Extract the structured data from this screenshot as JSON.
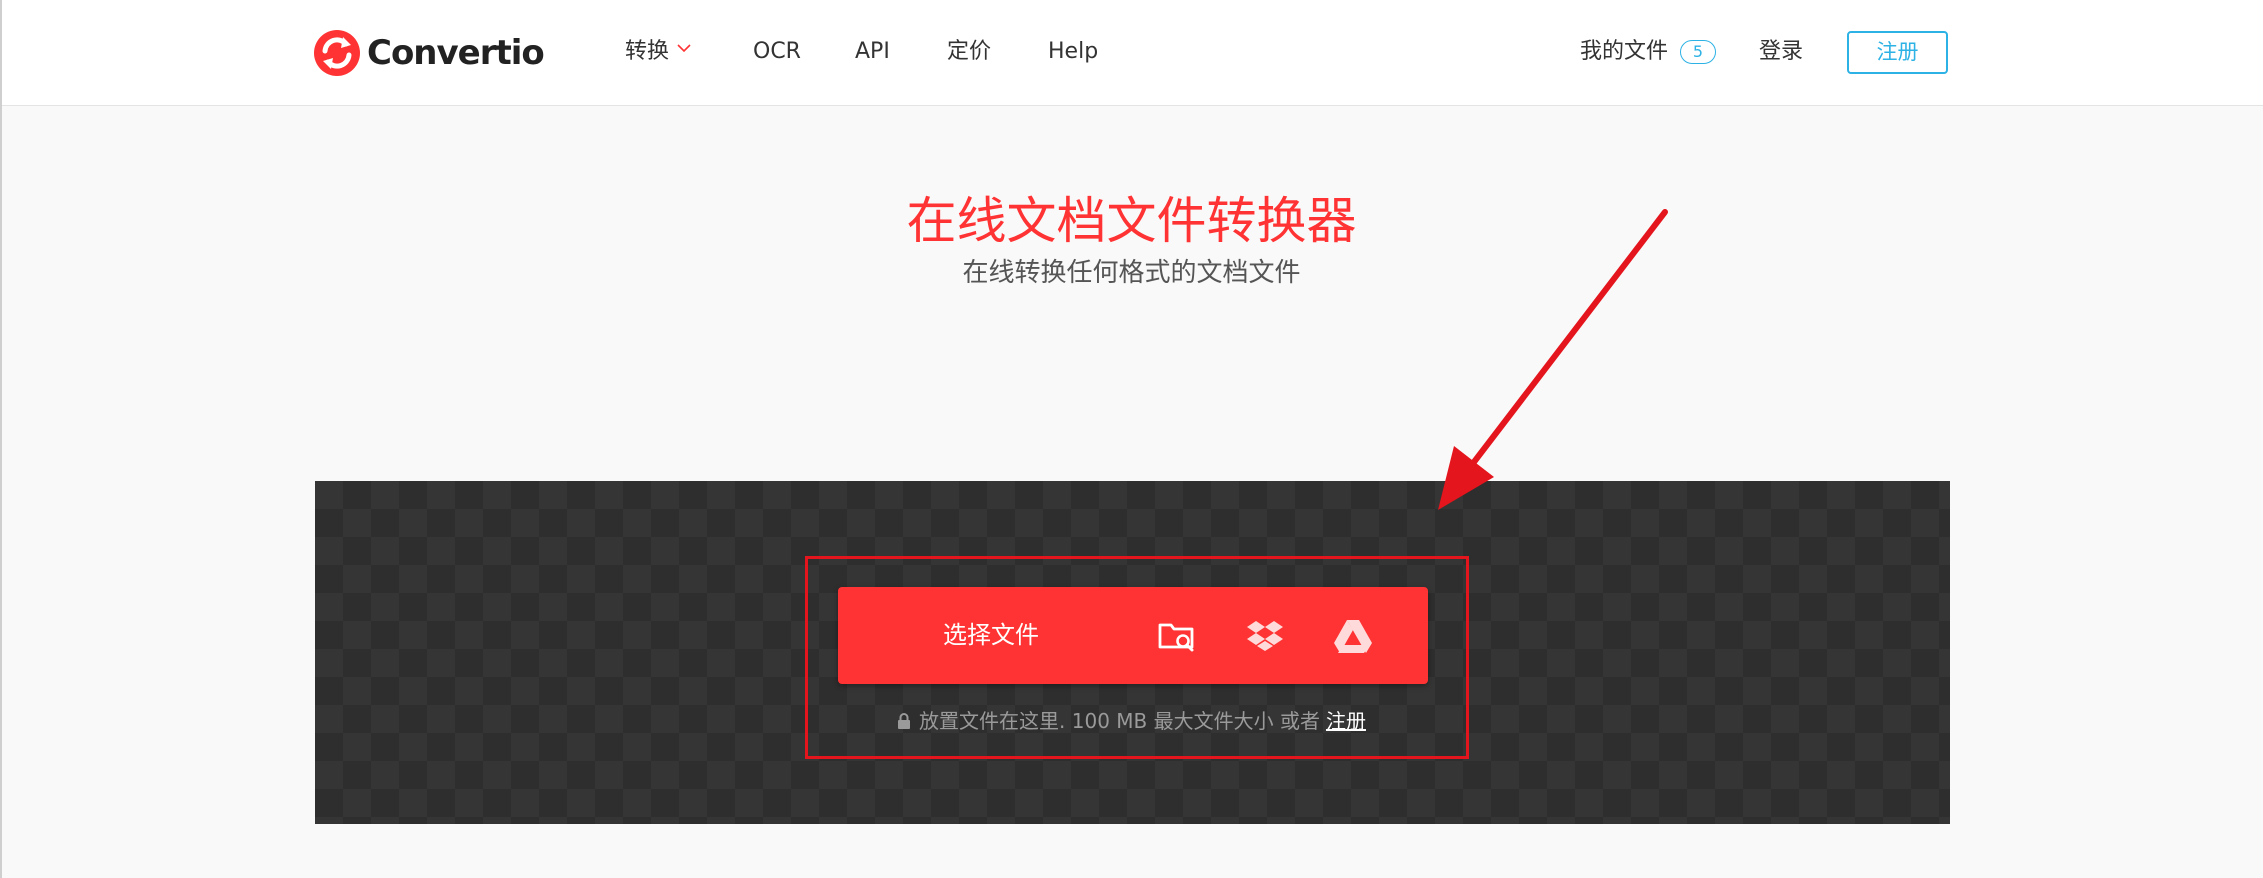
{
  "header": {
    "logo_text": "Convertio",
    "nav": {
      "convert": "转换",
      "ocr": "OCR",
      "api": "API",
      "pricing": "定价",
      "help": "Help"
    },
    "my_files_label": "我的文件",
    "my_files_count": "5",
    "login_label": "登录",
    "signup_label": "注册"
  },
  "hero": {
    "title": "在线文档文件转换器",
    "subtitle": "在线转换任何格式的文档文件"
  },
  "upload": {
    "choose_label": "选择文件",
    "source_icons": [
      "folder-search-icon",
      "dropbox-icon",
      "google-drive-icon"
    ],
    "hint_text": "放置文件在这里. 100 MB 最大文件大小 或者",
    "hint_link": "注册"
  },
  "colors": {
    "brand_red": "#ff3333",
    "accent_blue": "#2db2e5",
    "panel_dark": "#353535",
    "annotation_red": "#e4151d"
  }
}
